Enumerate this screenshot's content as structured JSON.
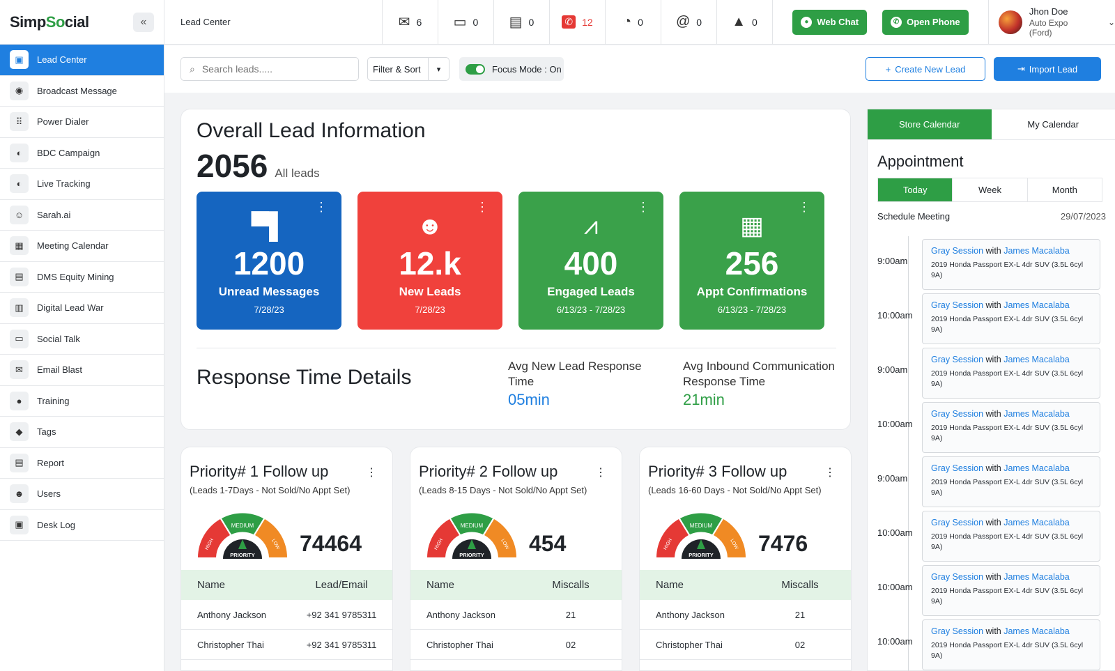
{
  "app": {
    "logo_prefix": "Simp",
    "logo_o": "So",
    "logo_suffix": "cial",
    "collapse_label": "«"
  },
  "sidebar": {
    "items": [
      {
        "label": "Lead Center",
        "icon": "▣"
      },
      {
        "label": "Broadcast Message",
        "icon": "◉"
      },
      {
        "label": "Power Dialer",
        "icon": "⠿"
      },
      {
        "label": "BDC Campaign",
        "icon": "◐"
      },
      {
        "label": "Live Tracking",
        "icon": "◐"
      },
      {
        "label": "Sarah.ai",
        "icon": "☺"
      },
      {
        "label": "Meeting Calendar",
        "icon": "▦"
      },
      {
        "label": "DMS Equity Mining",
        "icon": "▤"
      },
      {
        "label": "Digital Lead War",
        "icon": "▥"
      },
      {
        "label": "Social Talk",
        "icon": "▭"
      },
      {
        "label": "Email Blast",
        "icon": "✉"
      },
      {
        "label": "Training",
        "icon": "●"
      },
      {
        "label": "Tags",
        "icon": "◆"
      },
      {
        "label": "Report",
        "icon": "▤"
      },
      {
        "label": "Users",
        "icon": "☻"
      },
      {
        "label": "Desk Log",
        "icon": "▣"
      }
    ]
  },
  "topbar": {
    "title": "Lead Center",
    "counters": [
      {
        "icon": "✉",
        "count": "6"
      },
      {
        "icon": "▭",
        "count": "0"
      },
      {
        "icon": "▤",
        "count": "0"
      },
      {
        "icon": "✆",
        "count": "12"
      },
      {
        "icon": "◔",
        "count": "0"
      },
      {
        "icon": "@",
        "count": "0"
      },
      {
        "icon": "▲",
        "count": "0"
      }
    ],
    "web_chat_label": "Web Chat",
    "open_phone_label": "Open Phone",
    "user_name": "Jhon Doe",
    "user_org": "Auto Expo (Ford)"
  },
  "toolbar": {
    "search_placeholder": "Search leads.....",
    "filter_label": "Filter & Sort",
    "focus_label": "Focus Mode : On",
    "create_label": "Create New Lead",
    "import_label": "Import Lead"
  },
  "overview": {
    "title": "Overall Lead Information",
    "total": "2056",
    "total_label": "All leads",
    "stats": [
      {
        "value": "1200",
        "label": "Unread Messages",
        "date": "7/28/23",
        "color": "#1565c0",
        "icon": "chat-flag-icon"
      },
      {
        "value": "12.k",
        "label": "New Leads",
        "date": "7/28/23",
        "color": "#f0413c",
        "icon": "user-filter-icon"
      },
      {
        "value": "400",
        "label": "Engaged Leads",
        "date": "6/13/23 - 7/28/23",
        "color": "#3aa14a",
        "icon": "trend-icon"
      },
      {
        "value": "256",
        "label": "Appt Confirmations",
        "date": "6/13/23 - 7/28/23",
        "color": "#3aa14a",
        "icon": "calendar-icon"
      }
    ],
    "response_title": "Response Time Details",
    "avg_new_label": "Avg New Lead Response Time",
    "avg_new_value": "05min",
    "avg_new_color": "#1f7fe0",
    "avg_inbound_label": "Avg Inbound Communication Response Time",
    "avg_inbound_value": "21min",
    "avg_inbound_color": "#2e9e45"
  },
  "priority": [
    {
      "title": "Priority# 1 Follow up",
      "subtitle": "(Leads 1-7Days - Not Sold/No Appt Set)",
      "number": "74464",
      "col1": "Name",
      "col2": "Lead/Email",
      "rows": [
        {
          "name": "Anthony Jackson",
          "value": "+92 341 9785311"
        },
        {
          "name": "Christopher Thai",
          "value": "+92 341 9785311"
        }
      ]
    },
    {
      "title": "Priority# 2 Follow up",
      "subtitle": "(Leads 8-15 Days - Not Sold/No Appt Set)",
      "number": "454",
      "col1": "Name",
      "col2": "Miscalls",
      "rows": [
        {
          "name": "Anthony Jackson",
          "value": "21"
        },
        {
          "name": "Christopher Thai",
          "value": "02"
        }
      ]
    },
    {
      "title": "Priority# 3 Follow up",
      "subtitle": "(Leads 16-60 Days - Not Sold/No Appt Set)",
      "number": "7476",
      "col1": "Name",
      "col2": "Miscalls",
      "rows": [
        {
          "name": "Anthony Jackson",
          "value": "21"
        },
        {
          "name": "Christopher Thai",
          "value": "02"
        }
      ]
    }
  ],
  "gauge": {
    "high": "HIGH",
    "medium": "MEDIUM",
    "low": "LOW",
    "center": "PRIORITY"
  },
  "calendar": {
    "tabs": [
      "Store Calendar",
      "My Calendar"
    ],
    "title": "Appointment",
    "ranges": [
      "Today",
      "Week",
      "Month"
    ],
    "schedule_label": "Schedule Meeting",
    "schedule_date": "29/07/2023",
    "appointments": [
      {
        "time": "9:00am",
        "session": "Gray Session",
        "with": "with",
        "person": "James Macalaba",
        "car": "2019 Honda Passport EX-L 4dr SUV (3.5L 6cyl 9A)"
      },
      {
        "time": "10:00am",
        "session": "Gray Session",
        "with": "with",
        "person": "James Macalaba",
        "car": "2019 Honda Passport EX-L 4dr SUV (3.5L 6cyl 9A)"
      },
      {
        "time": "9:00am",
        "session": "Gray Session",
        "with": "with",
        "person": "James Macalaba",
        "car": "2019 Honda Passport EX-L 4dr SUV (3.5L 6cyl 9A)"
      },
      {
        "time": "10:00am",
        "session": "Gray Session",
        "with": "with",
        "person": "James Macalaba",
        "car": "2019 Honda Passport EX-L 4dr SUV (3.5L 6cyl 9A)"
      },
      {
        "time": "9:00am",
        "session": "Gray Session",
        "with": "with",
        "person": "James Macalaba",
        "car": "2019 Honda Passport EX-L 4dr SUV (3.5L 6cyl 9A)"
      },
      {
        "time": "10:00am",
        "session": "Gray Session",
        "with": "with",
        "person": "James Macalaba",
        "car": "2019 Honda Passport EX-L 4dr SUV (3.5L 6cyl 9A)"
      },
      {
        "time": "10:00am",
        "session": "Gray Session",
        "with": "with",
        "person": "James Macalaba",
        "car": "2019 Honda Passport EX-L 4dr SUV (3.5L 6cyl 9A)"
      },
      {
        "time": "10:00am",
        "session": "Gray Session",
        "with": "with",
        "person": "James Macalaba",
        "car": "2019 Honda Passport EX-L 4dr SUV (3.5L 6cyl 9A)"
      }
    ]
  }
}
